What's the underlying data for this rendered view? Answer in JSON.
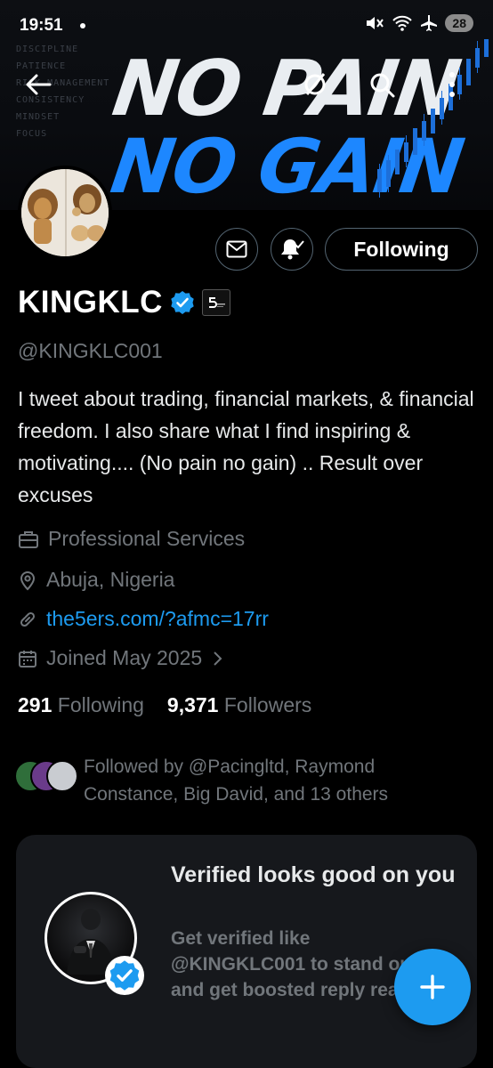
{
  "status_bar": {
    "time": "19:51",
    "battery": "28"
  },
  "banner": {
    "slogan_line1": "NO PAIN",
    "slogan_line2": "NO GAIN",
    "side_words": [
      "DISCIPLINE",
      "PATIENCE",
      "RISK MANAGEMENT",
      "CONSISTENCY",
      "MINDSET",
      "FOCUS"
    ]
  },
  "actions": {
    "follow_label": "Following"
  },
  "profile": {
    "name": "KINGKLC",
    "handle": "@KINGKLC001",
    "bio": "I tweet about trading, financial markets, & financial freedom. I also share what I find inspiring & motivating.... (No pain no gain) .. Result over excuses",
    "category": "Professional Services",
    "location": "Abuja, Nigeria",
    "link": "the5ers.com/?afmc=17rr",
    "joined": "Joined May 2025",
    "following_count": "291",
    "following_label": "Following",
    "followers_count": "9,371",
    "followers_label": "Followers",
    "followed_by": "Followed by @Pacingltd, Raymond Constance, Big David, and 13 others"
  },
  "verified_card": {
    "title": "Verified looks good on you",
    "description": "Get verified like @KINGKLC001 to stand out and get boosted reply reach."
  },
  "colors": {
    "accent": "#1d9bf0",
    "background": "#000000",
    "secondary_text": "#71767b",
    "card_bg": "#16181c"
  }
}
